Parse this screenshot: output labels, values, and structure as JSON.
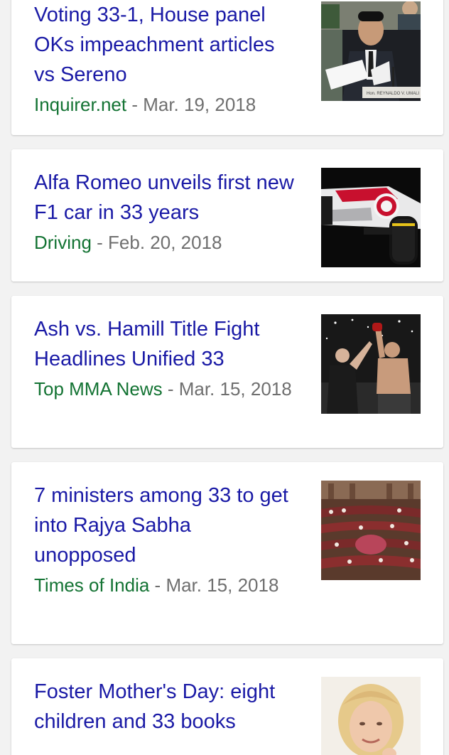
{
  "articles": [
    {
      "headline": "Voting 33-1, House panel OKs impeachment articles vs Sereno",
      "source": "Inquirer.net",
      "separator": " - ",
      "date": "Mar. 19, 2018",
      "thumbnail_caption": "Hon. REYNALDO V. UMALI"
    },
    {
      "headline": "Alfa Romeo unveils first new F1 car in 33 years",
      "source": "Driving",
      "separator": " - ",
      "date": "Feb. 20, 2018"
    },
    {
      "headline": "Ash vs. Hamill Title Fight Headlines Unified 33",
      "source": "Top MMA News",
      "separator": " - ",
      "date": "Mar. 15, 2018"
    },
    {
      "headline": "7 ministers among 33 to get into Rajya Sabha unopposed",
      "source": "Times of India",
      "separator": " - ",
      "date": "Mar. 15, 2018"
    },
    {
      "headline": "Foster Mother's Day: eight children and 33 books",
      "source": "",
      "separator": "",
      "date": ""
    }
  ],
  "colors": {
    "headline": "#1a1aa6",
    "source": "#137333",
    "date": "#6f6f6f",
    "background": "#f2f2f2",
    "card": "#ffffff"
  }
}
